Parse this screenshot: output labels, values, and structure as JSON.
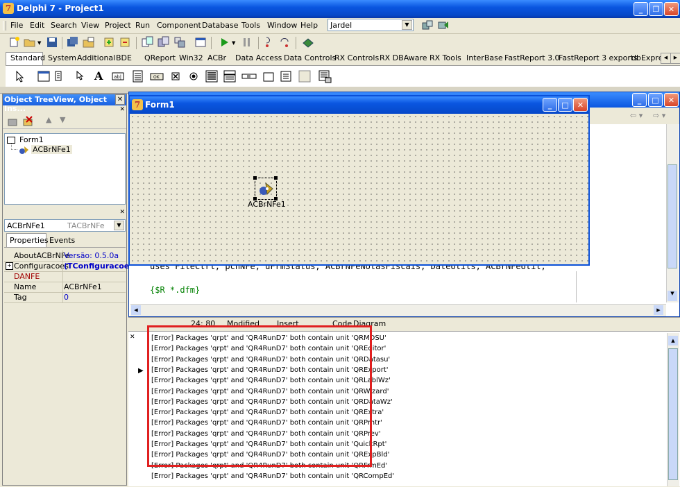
{
  "app": {
    "title": "Delphi 7 - Project1"
  },
  "menu": [
    "File",
    "Edit",
    "Search",
    "View",
    "Project",
    "Run",
    "Component",
    "Database",
    "Tools",
    "Window",
    "Help"
  ],
  "desktop_combo": {
    "value": "Jardel"
  },
  "palette_tabs": [
    "Standard",
    "System",
    "Additional",
    "BDE",
    "QReport",
    "Win32",
    "ACBr",
    "Data Access",
    "Data Controls",
    "RX Controls",
    "RX DBAware",
    "RX Tools",
    "InterBase",
    "FastReport 3.0",
    "FastReport 3 exports",
    "dbExpre..."
  ],
  "object_treeview": {
    "title": "Object TreeView, Object Ins...",
    "nodes": [
      "Form1",
      "ACBrNFe1"
    ]
  },
  "object_inspector": {
    "selected_name": "ACBrNFe1",
    "selected_type": "TACBrNFe",
    "tabs": [
      "Properties",
      "Events"
    ],
    "rows": [
      {
        "name": "AboutACBrNFe",
        "value": "Versão: 0.5.0a"
      },
      {
        "name": "Configuracoes",
        "value": "(TConfiguracoes"
      },
      {
        "name": "DANFE",
        "value": ""
      },
      {
        "name": "Name",
        "value": "ACBrNFe1"
      },
      {
        "name": "Tag",
        "value": "0"
      }
    ]
  },
  "form": {
    "title": "Form1",
    "component_label": "ACBrNFe1"
  },
  "code_editor": {
    "line1": "uses FileCtrl, pcnNFe, uFrmStatus, ACBrNFeNotasFiscais, DateUtils, ACBrNFeUtil;",
    "line2": "{$R *.dfm}",
    "status_pos": "24: 80",
    "status_modified": "Modified",
    "status_mode": "Insert",
    "tabs": [
      "Code",
      "Diagram"
    ]
  },
  "messages": [
    "[Error] Packages 'qrpt' and 'QR4RunD7' both contain unit 'QRMDSU'",
    "[Error] Packages 'qrpt' and 'QR4RunD7' both contain unit 'QREditor'",
    "[Error] Packages 'qrpt' and 'QR4RunD7' both contain unit 'QRDatasu'",
    "[Error] Packages 'qrpt' and 'QR4RunD7' both contain unit 'QRExport'",
    "[Error] Packages 'qrpt' and 'QR4RunD7' both contain unit 'QRLablWz'",
    "[Error] Packages 'qrpt' and 'QR4RunD7' both contain unit 'QRWizard'",
    "[Error] Packages 'qrpt' and 'QR4RunD7' both contain unit 'QRDataWz'",
    "[Error] Packages 'qrpt' and 'QR4RunD7' both contain unit 'QRExtra'",
    "[Error] Packages 'qrpt' and 'QR4RunD7' both contain unit 'QRPrntr'",
    "[Error] Packages 'qrpt' and 'QR4RunD7' both contain unit 'QRPrev'",
    "[Error] Packages 'qrpt' and 'QR4RunD7' both contain unit 'QuickRpt'",
    "[Error] Packages 'qrpt' and 'QR4RunD7' both contain unit 'QRExpBld'",
    "[Error] Packages 'qrpt' and 'QR4RunD7' both contain unit 'QRFrmEd'",
    "[Error] Packages 'qrpt' and 'QR4RunD7' both contain unit 'QRCompEd'"
  ],
  "colors": {
    "title_blue": "#0a56e0",
    "highlight_red": "#e02020",
    "selection": "#316ac5"
  }
}
